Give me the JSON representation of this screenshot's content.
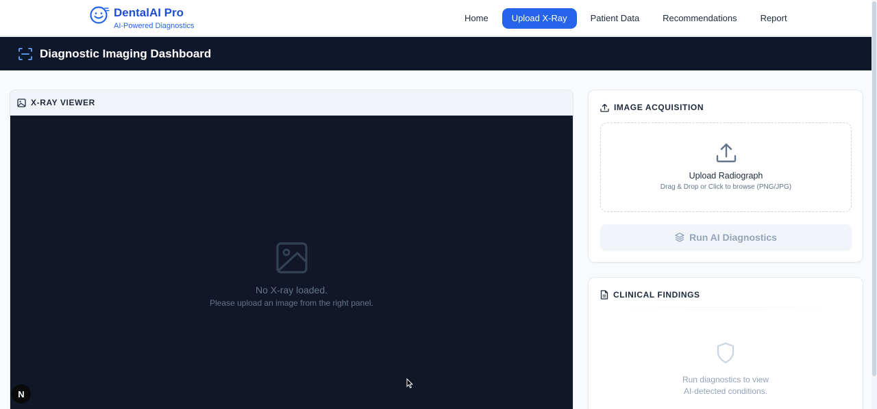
{
  "brand": {
    "name": "DentalAI Pro",
    "tagline": "AI-Powered Diagnostics"
  },
  "nav": {
    "items": [
      {
        "label": "Home",
        "active": false
      },
      {
        "label": "Upload X-Ray",
        "active": true
      },
      {
        "label": "Patient Data",
        "active": false
      },
      {
        "label": "Recommendations",
        "active": false
      },
      {
        "label": "Report",
        "active": false
      }
    ]
  },
  "header": {
    "title": "Diagnostic Imaging Dashboard",
    "icon": "scan-icon"
  },
  "viewer": {
    "title": "X-RAY VIEWER",
    "empty_title": "No X-ray loaded.",
    "empty_sub": "Please upload an image from the right panel."
  },
  "acquisition": {
    "title": "IMAGE ACQUISITION",
    "dropzone_title": "Upload Radiograph",
    "dropzone_sub": "Drag & Drop or Click to browse (PNG/JPG)",
    "run_button": "Run AI Diagnostics"
  },
  "findings": {
    "title": "CLINICAL FINDINGS",
    "empty_line1": "Run diagnostics to view",
    "empty_line2": "AI-detected conditions."
  },
  "badge": {
    "label": "N"
  },
  "colors": {
    "accent": "#2563eb",
    "header_bg": "#0f172a",
    "viewer_bg": "#111729",
    "page_bg": "#f8fafc"
  }
}
